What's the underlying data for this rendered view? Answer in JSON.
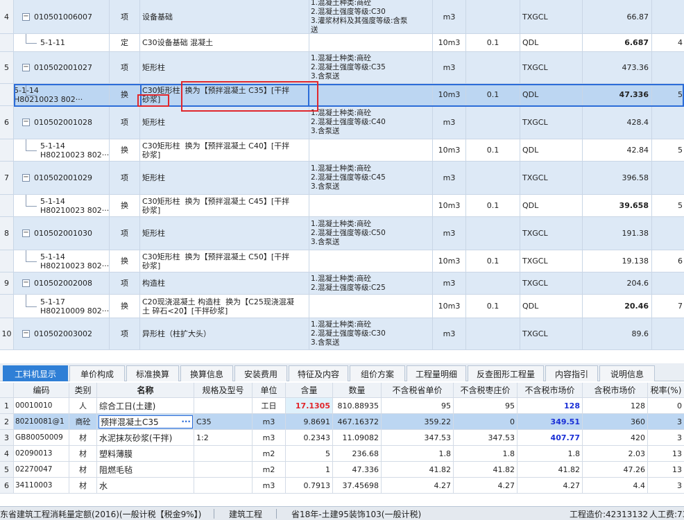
{
  "top_rows": [
    {
      "num": "4",
      "type": "item",
      "code": "010501006007",
      "cat": "项",
      "name": "设备基础",
      "features": "1.混凝土种类:商砼\n2.混凝土强度等级:C30\n3.灌浆材料及其强度等级:含泵\n送",
      "unit": "m3",
      "qty": "",
      "expr": "TXGCL",
      "val": "66.87",
      "val_bold": false,
      "last": ""
    },
    {
      "num": "",
      "type": "sub",
      "code": "5-1-11",
      "cat": "定",
      "name": "C30设备基础 混凝土",
      "features": "",
      "unit": "10m3",
      "qty": "0.1",
      "expr": "QDL",
      "val": "6.687",
      "val_bold": true,
      "last": "4"
    },
    {
      "num": "5",
      "type": "item",
      "code": "010502001027",
      "cat": "项",
      "name": "矩形柱",
      "features": "1.混凝土种类:商砼\n2.混凝土强度等级:C35\n3.含泵送",
      "unit": "m3",
      "qty": "",
      "expr": "TXGCL",
      "val": "473.36",
      "val_bold": false,
      "last": ""
    },
    {
      "num": "",
      "type": "sel",
      "code": "5-1-14\nH80210023 802···",
      "cat": "换",
      "name": "C30矩形柱  换为【预拌混凝土 C35】[干拌\n砂浆]",
      "features": "",
      "unit": "10m3",
      "qty": "0.1",
      "expr": "QDL",
      "val": "47.336",
      "val_bold": true,
      "last": "5"
    },
    {
      "num": "6",
      "type": "item",
      "code": "010502001028",
      "cat": "项",
      "name": "矩形柱",
      "features": "1.混凝土种类:商砼\n2.混凝土强度等级:C40\n3.含泵送",
      "unit": "m3",
      "qty": "",
      "expr": "TXGCL",
      "val": "428.4",
      "val_bold": false,
      "last": ""
    },
    {
      "num": "",
      "type": "sub",
      "code": "5-1-14\nH80210023 802···",
      "cat": "换",
      "name": "C30矩形柱  换为【预拌混凝土 C40】[干拌\n砂浆]",
      "features": "",
      "unit": "10m3",
      "qty": "0.1",
      "expr": "QDL",
      "val": "42.84",
      "val_bold": false,
      "last": "5"
    },
    {
      "num": "7",
      "type": "item",
      "code": "010502001029",
      "cat": "项",
      "name": "矩形柱",
      "features": "1.混凝土种类:商砼\n2.混凝土强度等级:C45\n3.含泵送",
      "unit": "m3",
      "qty": "",
      "expr": "TXGCL",
      "val": "396.58",
      "val_bold": false,
      "last": ""
    },
    {
      "num": "",
      "type": "sub",
      "code": "5-1-14\nH80210023 802···",
      "cat": "换",
      "name": "C30矩形柱  换为【预拌混凝土 C45】[干拌\n砂浆]",
      "features": "",
      "unit": "10m3",
      "qty": "0.1",
      "expr": "QDL",
      "val": "39.658",
      "val_bold": true,
      "last": "5"
    },
    {
      "num": "8",
      "type": "item",
      "code": "010502001030",
      "cat": "项",
      "name": "矩形柱",
      "features": "1.混凝土种类:商砼\n2.混凝土强度等级:C50\n3.含泵送",
      "unit": "m3",
      "qty": "",
      "expr": "TXGCL",
      "val": "191.38",
      "val_bold": false,
      "last": ""
    },
    {
      "num": "",
      "type": "sub",
      "code": "5-1-14\nH80210023 802···",
      "cat": "换",
      "name": "C30矩形柱  换为【预拌混凝土 C50】[干拌\n砂浆]",
      "features": "",
      "unit": "10m3",
      "qty": "0.1",
      "expr": "TXGCL",
      "val": "19.138",
      "val_bold": false,
      "last": "6"
    },
    {
      "num": "9",
      "type": "item",
      "code": "010502002008",
      "cat": "项",
      "name": "构造柱",
      "features": "1.混凝土种类:商砼\n2.混凝土强度等级:C25",
      "unit": "m3",
      "qty": "",
      "expr": "TXGCL",
      "val": "204.6",
      "val_bold": false,
      "last": ""
    },
    {
      "num": "",
      "type": "sub",
      "code": "5-1-17\nH80210009 802···",
      "cat": "换",
      "name": "C20现浇混凝土 构造柱  换为【C25现浇混凝\n土 碎石<20】[干拌砂浆]",
      "features": "",
      "unit": "10m3",
      "qty": "0.1",
      "expr": "QDL",
      "val": "20.46",
      "val_bold": true,
      "last": "7"
    },
    {
      "num": "10",
      "type": "item",
      "code": "010502003002",
      "cat": "项",
      "name": "异形柱（柱扩大头）",
      "features": "1.混凝土种类:商砼\n2.混凝土强度等级:C30\n3.含泵送",
      "unit": "m3",
      "qty": "",
      "expr": "TXGCL",
      "val": "89.6",
      "val_bold": false,
      "last": ""
    }
  ],
  "tabs": [
    "工料机显示",
    "单价构成",
    "标准换算",
    "换算信息",
    "安装费用",
    "特征及内容",
    "组价方案",
    "工程量明细",
    "反查图形工程量",
    "内容指引",
    "说明信息"
  ],
  "bottom_headers": [
    "编码",
    "类别",
    "名称",
    "规格及型号",
    "单位",
    "含量",
    "数量",
    "不含税省单价",
    "不含税枣庄价",
    "不含税市场价",
    "含税市场价",
    "税率(%)"
  ],
  "bottom_rows": [
    {
      "idx": "1",
      "code": "00010010",
      "cat": "人",
      "name": "综合工日(土建)",
      "spec": "",
      "unit": "工日",
      "cnt": "17.1305",
      "qty": "810.88935",
      "p1": "95",
      "p2": "95",
      "p3": "128",
      "p4": "128",
      "tax": "0"
    },
    {
      "idx": "2",
      "code": "80210081@1",
      "cat": "商砼",
      "name": "预拌混凝土C35",
      "spec": "C35",
      "unit": "m3",
      "cnt": "9.8691",
      "qty": "467.16372",
      "p1": "359.22",
      "p2": "0",
      "p3": "349.51",
      "p4": "360",
      "tax": "3"
    },
    {
      "idx": "3",
      "code": "GB80050009",
      "cat": "材",
      "name": "水泥抹灰砂浆(干拌)",
      "spec": "1:2",
      "unit": "m3",
      "cnt": "0.2343",
      "qty": "11.09082",
      "p1": "347.53",
      "p2": "347.53",
      "p3": "407.77",
      "p4": "420",
      "tax": "3"
    },
    {
      "idx": "4",
      "code": "02090013",
      "cat": "材",
      "name": "塑料薄膜",
      "spec": "",
      "unit": "m2",
      "cnt": "5",
      "qty": "236.68",
      "p1": "1.8",
      "p2": "1.8",
      "p3": "1.8",
      "p4": "2.03",
      "tax": "13"
    },
    {
      "idx": "5",
      "code": "02270047",
      "cat": "材",
      "name": "阻燃毛毡",
      "spec": "",
      "unit": "m2",
      "cnt": "1",
      "qty": "47.336",
      "p1": "41.82",
      "p2": "41.82",
      "p3": "41.82",
      "p4": "47.26",
      "tax": "13"
    },
    {
      "idx": "6",
      "code": "34110003",
      "cat": "材",
      "name": "水",
      "spec": "",
      "unit": "m3",
      "cnt": "0.7913",
      "qty": "37.45698",
      "p1": "4.27",
      "p2": "4.27",
      "p3": "4.27",
      "p4": "4.4",
      "tax": "3"
    }
  ],
  "status": {
    "quota": "东省建筑工程消耗量定额(2016)(一般计税【税金9%】)",
    "profession": "建筑工程",
    "price": "省18年-土建95装饰103(一般计税)",
    "cost": "工程造价:42313132",
    "labor": "人工费:73"
  }
}
